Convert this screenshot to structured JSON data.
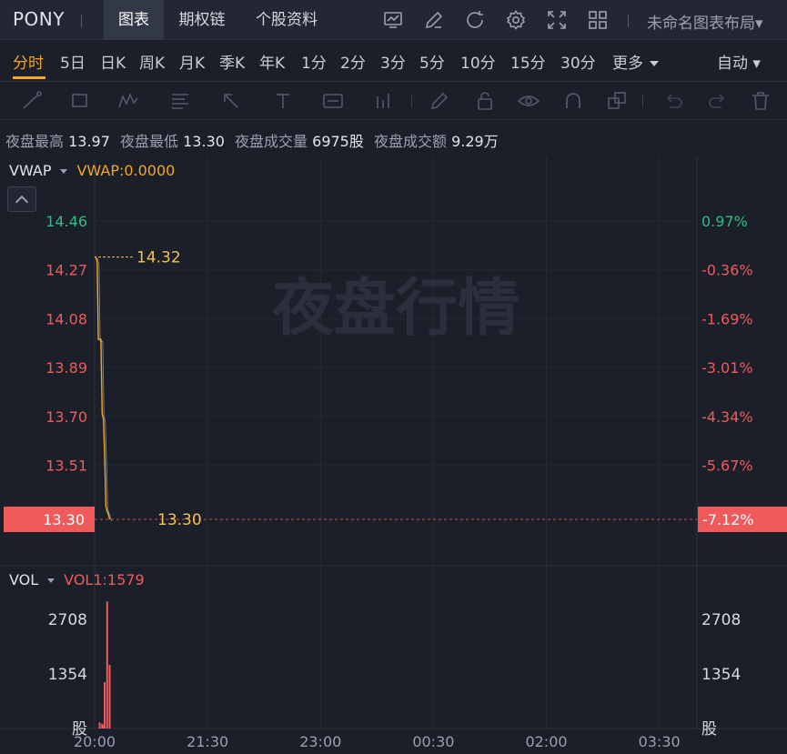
{
  "header": {
    "symbol": "PONY",
    "tabs": [
      {
        "label": "图表",
        "active": true
      },
      {
        "label": "期权链",
        "active": false
      },
      {
        "label": "个股资料",
        "active": false
      }
    ],
    "icons": [
      "indicator-chart-icon",
      "draw-pen-icon",
      "refresh-icon",
      "settings-gear-icon",
      "fullscreen-icon",
      "grid-layout-icon"
    ],
    "layout_name": "未命名图表布局",
    "layout_caret": "▾"
  },
  "intervals": {
    "items": [
      "分时",
      "5日",
      "日K",
      "周K",
      "月K",
      "季K",
      "年K",
      "1分",
      "2分",
      "3分",
      "5分",
      "10分",
      "15分",
      "30分"
    ],
    "active": "分时",
    "more_label": "更多",
    "auto_label": "自动",
    "auto_caret": "▾"
  },
  "drawing_tools": [
    "trend-line-icon",
    "rectangle-icon",
    "pattern-icon",
    "fib-icon",
    "arrow-icon",
    "text-icon",
    "annotation-icon",
    "bar-pattern-icon",
    "brush-icon",
    "lock-icon",
    "eye-icon",
    "magnet-icon",
    "layers-icon",
    "undo-icon",
    "redo-icon",
    "trash-icon"
  ],
  "stats": [
    {
      "label": "夜盘最高",
      "value": "13.97"
    },
    {
      "label": "夜盘最低",
      "value": "13.30"
    },
    {
      "label": "夜盘成交量",
      "value": "6975股"
    },
    {
      "label": "夜盘成交额",
      "value": "9.29万"
    }
  ],
  "main_pane": {
    "indicator": "VWAP",
    "indicator_value": "VWAP:0.0000",
    "watermark": "夜盘行情",
    "price_axis": [
      "14.46",
      "14.27",
      "14.08",
      "13.89",
      "13.70",
      "13.51"
    ],
    "pct_axis": [
      "0.97%",
      "-0.36%",
      "-1.69%",
      "-3.01%",
      "-4.34%",
      "-5.67%"
    ],
    "current_price": "13.30",
    "current_pct": "-7.12%",
    "high_label": "14.32",
    "low_label": "13.30"
  },
  "vol_pane": {
    "indicator": "VOL",
    "indicator_value": "VOL1:1579",
    "axis_left": [
      "2708",
      "1354",
      "股"
    ],
    "axis_right": [
      "2708",
      "1354",
      "股"
    ]
  },
  "time_axis": [
    "20:00",
    "21:30",
    "23:00",
    "00:30",
    "02:00",
    "03:30"
  ],
  "colors": {
    "background": "#1b1f29",
    "up": "#2dbd85",
    "down": "#f05a5a",
    "accent": "#f5a623",
    "price_line": "#f5a623",
    "label_yellow": "#f5c24d",
    "volume_bar": "#f05a5a"
  },
  "chart_data": {
    "type": "line",
    "price_series": {
      "x": [
        "20:00",
        "20:01",
        "20:02",
        "20:03",
        "20:04",
        "20:05",
        "20:06",
        "20:07",
        "20:08",
        "20:09",
        "20:10",
        "20:11",
        "20:12"
      ],
      "y": [
        14.32,
        14.32,
        14.3,
        14.0,
        14.0,
        14.0,
        13.71,
        13.69,
        13.55,
        13.35,
        13.33,
        13.32,
        13.3
      ]
    },
    "volume_series": {
      "x": [
        "20:04",
        "20:05",
        "20:06",
        "20:07",
        "20:08",
        "20:09",
        "20:10",
        "20:11",
        "20:12"
      ],
      "values": [
        150,
        0,
        120,
        80,
        1150,
        0,
        3150,
        0,
        1579
      ]
    },
    "ylim": [
      13.3,
      14.46
    ],
    "vol_ylim": [
      0,
      2708
    ],
    "xlim": [
      "20:00",
      "04:00"
    ]
  }
}
